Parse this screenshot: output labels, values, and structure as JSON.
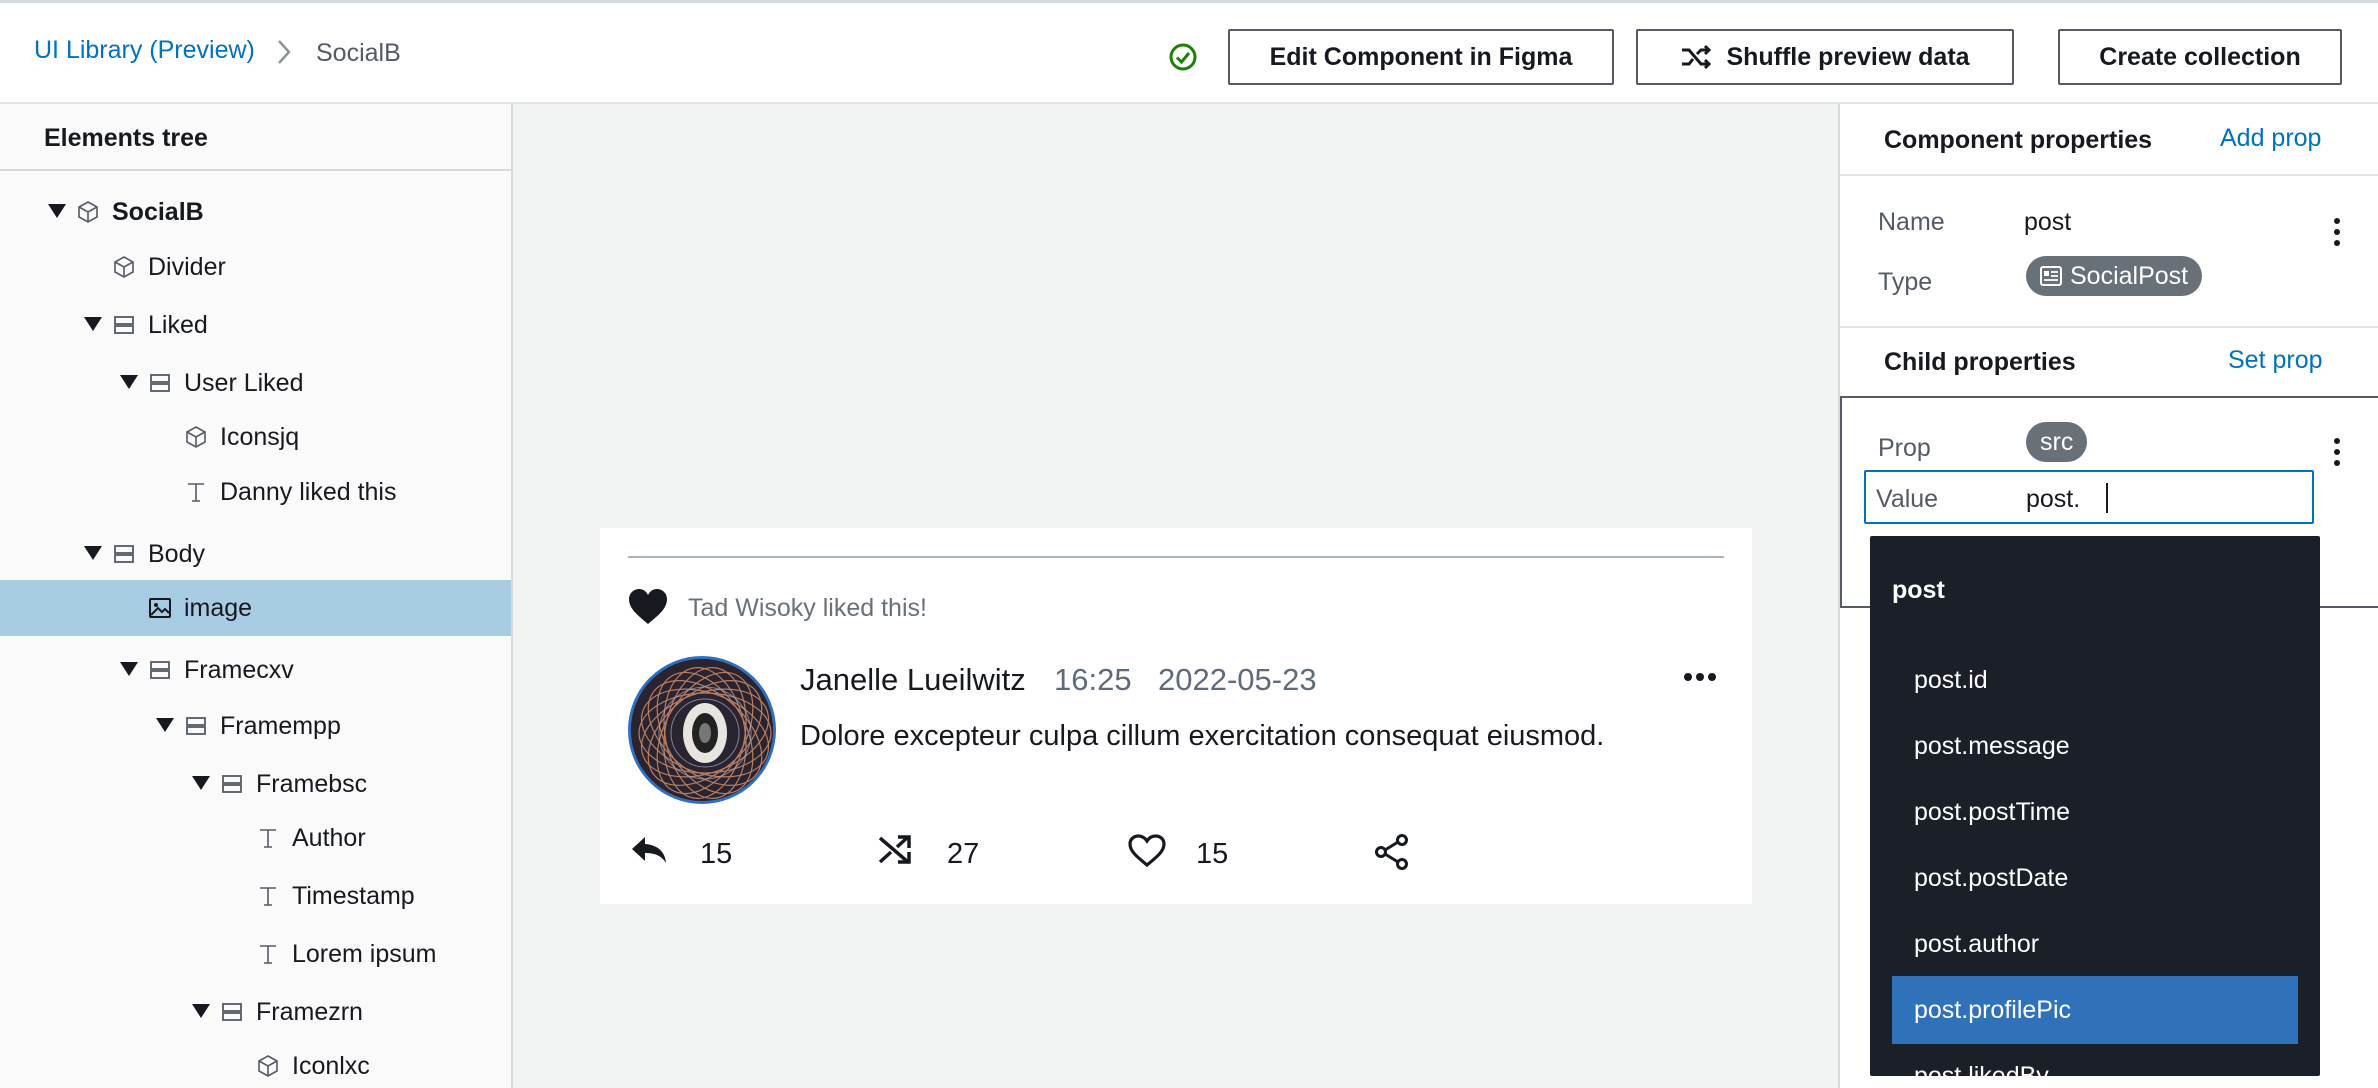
{
  "header": {
    "breadcrumb_root": "UI Library (Preview)",
    "breadcrumb_current": "SocialB",
    "status_icon": "check-circle-icon",
    "edit_button": "Edit Component in Figma",
    "shuffle_button": "Shuffle preview data",
    "create_button": "Create collection"
  },
  "tree": {
    "title": "Elements tree",
    "items": [
      {
        "label": "SocialB",
        "icon": "cube-icon",
        "expanded": true,
        "depth": 0,
        "bold": true
      },
      {
        "label": "Divider",
        "icon": "cube-icon",
        "depth": 1
      },
      {
        "label": "Liked",
        "icon": "frame-icon",
        "expanded": true,
        "depth": 1
      },
      {
        "label": "User Liked",
        "icon": "frame-icon",
        "expanded": true,
        "depth": 2
      },
      {
        "label": "Iconsjq",
        "icon": "cube-icon",
        "depth": 3
      },
      {
        "label": "Danny liked this",
        "icon": "text-icon",
        "depth": 3
      },
      {
        "label": "Body",
        "icon": "frame-icon",
        "expanded": true,
        "depth": 1
      },
      {
        "label": "image",
        "icon": "image-icon",
        "depth": 2,
        "selected": true
      },
      {
        "label": "Framecxv",
        "icon": "frame-icon",
        "expanded": true,
        "depth": 2
      },
      {
        "label": "Framempp",
        "icon": "frame-icon",
        "expanded": true,
        "depth": 3
      },
      {
        "label": "Framebsc",
        "icon": "frame-icon",
        "expanded": true,
        "depth": 4
      },
      {
        "label": "Author",
        "icon": "text-icon",
        "depth": 5
      },
      {
        "label": "Timestamp",
        "icon": "text-icon",
        "depth": 5
      },
      {
        "label": "Lorem ipsum",
        "icon": "text-icon",
        "depth": 5
      },
      {
        "label": "Framezrn",
        "icon": "frame-icon",
        "expanded": true,
        "depth": 4
      },
      {
        "label": "Iconlxc",
        "icon": "cube-icon",
        "depth": 5
      }
    ]
  },
  "preview": {
    "liked_text": "Tad Wisoky liked this!",
    "author": "Janelle Lueilwitz",
    "time": "16:25",
    "date": "2022-05-23",
    "message": "Dolore excepteur culpa cillum exercitation consequat eiusmod.",
    "reply_count": "15",
    "shuffle_count": "27",
    "like_count": "15"
  },
  "props": {
    "component_title": "Component properties",
    "add_prop": "Add prop",
    "name_label": "Name",
    "name_value": "post",
    "type_label": "Type",
    "type_value": "SocialPost",
    "child_title": "Child properties",
    "set_prop": "Set prop",
    "prop_label": "Prop",
    "prop_value": "src",
    "value_label": "Value",
    "value_input": "post."
  },
  "dropdown": {
    "group": "post",
    "items": [
      "post.id",
      "post.message",
      "post.postTime",
      "post.postDate",
      "post.author",
      "post.profilePic",
      "post.likedBy"
    ],
    "active_index": 5
  },
  "colors": {
    "link": "#0073bb",
    "selected_row": "#a8cde3",
    "dropdown_bg": "#1b1f27",
    "dropdown_active": "#2f72b9",
    "success": "#1d8102"
  }
}
